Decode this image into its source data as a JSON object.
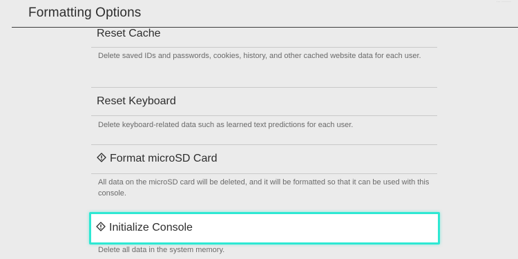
{
  "header": {
    "title": "Formatting Options",
    "corner_text": "··· ·······"
  },
  "options": [
    {
      "title": "Reset Cache",
      "description": "Delete saved IDs and passwords, cookies, history, and other cached website data for each user.",
      "warning_icon": false
    },
    {
      "title": "Reset Keyboard",
      "description": "Delete keyboard-related data such as learned text predictions for each user.",
      "warning_icon": false
    },
    {
      "title": "Format microSD Card",
      "description": "All data on the microSD card will be deleted, and it will be formatted so that it can be used with this console.",
      "warning_icon": true
    },
    {
      "title": "Initialize Console",
      "description": "Delete all data in the system memory.",
      "warning_icon": true,
      "selected": true
    }
  ],
  "colors": {
    "background": "#ebebeb",
    "focus_border": "#2ee8d3",
    "text_primary": "#2d2d2d",
    "text_secondary": "#6a6a6a"
  },
  "icons": {
    "warning": "warning-diamond-icon"
  }
}
